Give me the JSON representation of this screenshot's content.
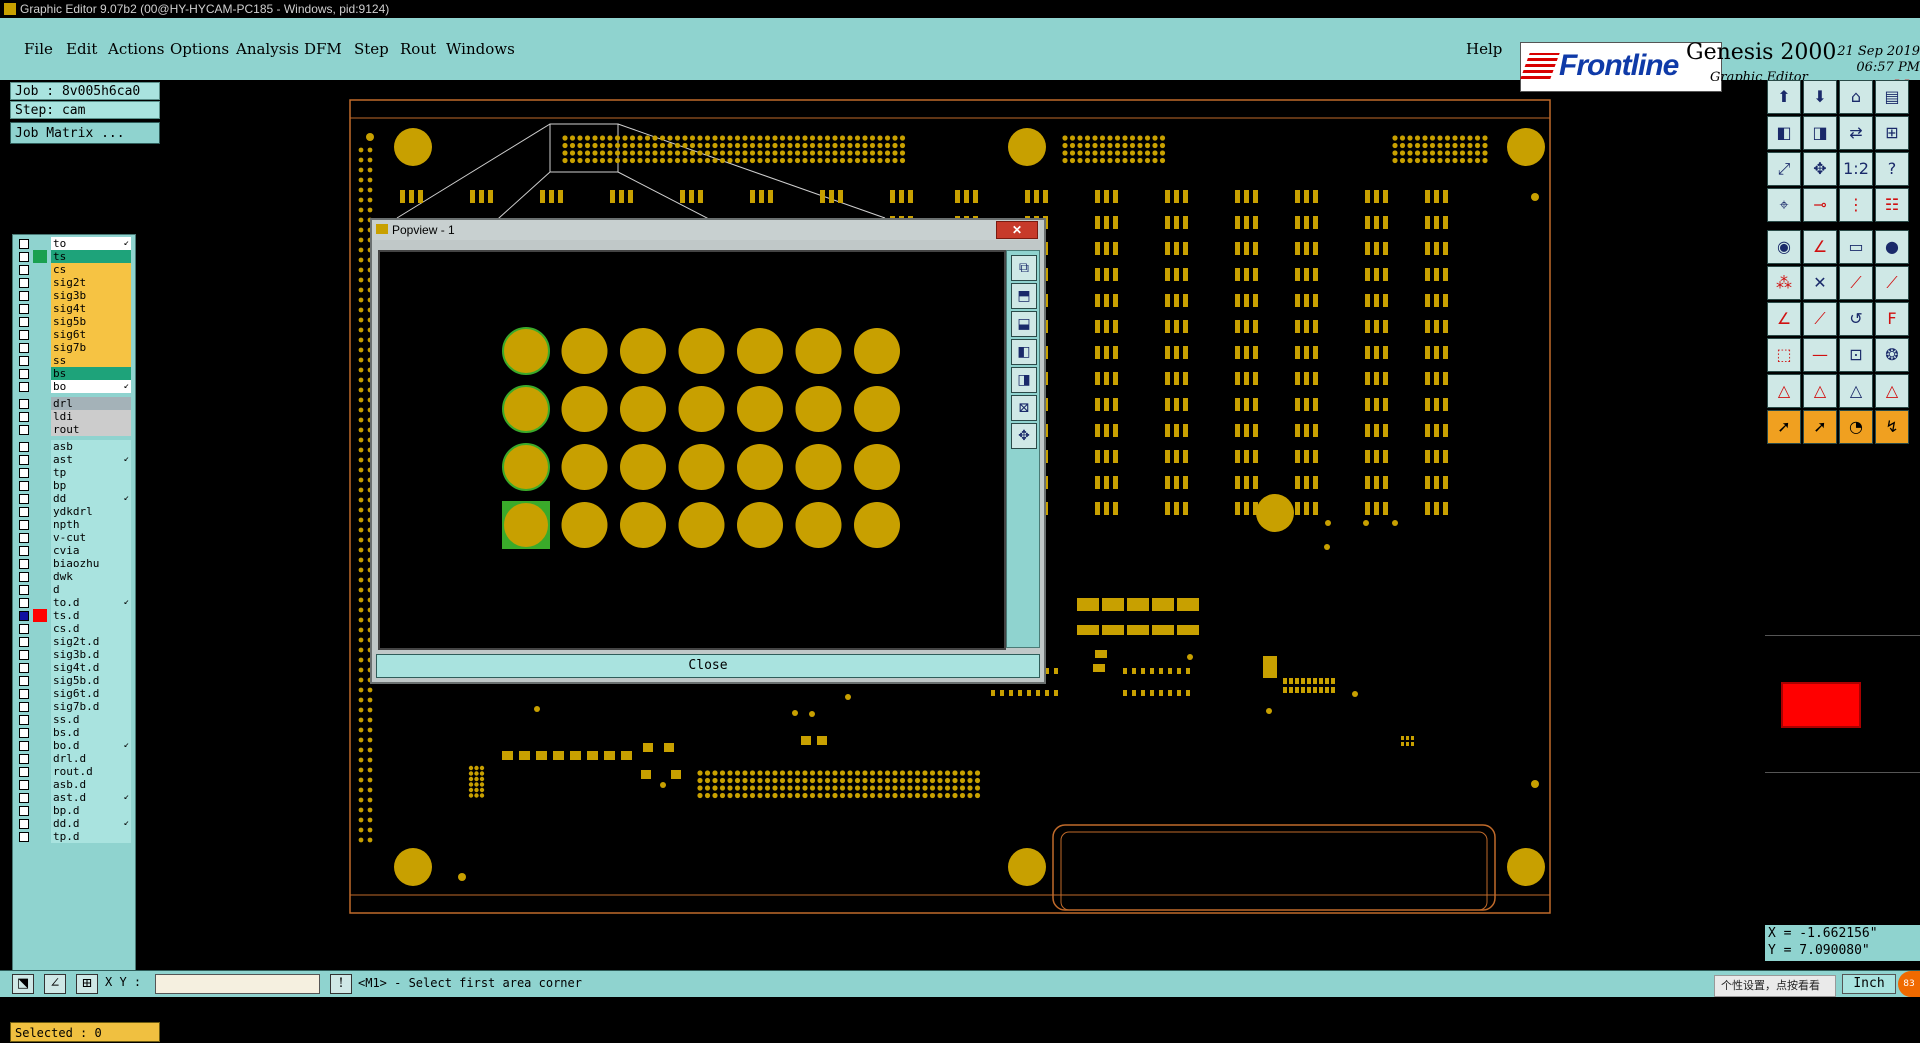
{
  "window": {
    "title": "Graphic Editor 9.07b2 (00@HY-HYCAM-PC185 - Windows, pid:9124)"
  },
  "menu": {
    "items": [
      "File",
      "Edit",
      "Actions",
      "Options",
      "Analysis",
      "DFM",
      "Step",
      "Rout",
      "Windows"
    ],
    "help": "Help"
  },
  "brand": {
    "logo": "Frontline",
    "product": "Genesis 2000",
    "subtitle": "Graphic Editor",
    "date": "21 Sep 2019\n06:57 PM"
  },
  "info": {
    "job": "Job : 8v005h6ca0",
    "step": "Step: cam",
    "matrix_button": "Job Matrix ..."
  },
  "layers": [
    {
      "name": "to",
      "color": "#ffffff",
      "arrow": true
    },
    {
      "name": "ts",
      "color": "#1ea37a",
      "marker": "#1aa050"
    },
    {
      "name": "cs",
      "color": "#f6c343"
    },
    {
      "name": "sig2t",
      "color": "#f6c343"
    },
    {
      "name": "sig3b",
      "color": "#f6c343"
    },
    {
      "name": "sig4t",
      "color": "#f6c343"
    },
    {
      "name": "sig5b",
      "color": "#f6c343"
    },
    {
      "name": "sig6t",
      "color": "#f6c343"
    },
    {
      "name": "sig7b",
      "color": "#f6c343"
    },
    {
      "name": "ss",
      "color": "#f6c343"
    },
    {
      "name": "bs",
      "color": "#1ea37a"
    },
    {
      "name": "bo",
      "color": "#ffffff",
      "arrow": true
    },
    {
      "name": "drl",
      "color": "#a4b2b8",
      "gap": true
    },
    {
      "name": "ldi",
      "color": "#cccccc"
    },
    {
      "name": "rout",
      "color": "#cccccc"
    },
    {
      "name": "asb",
      "color": "#a9e3df",
      "gap": true
    },
    {
      "name": "ast",
      "color": "#a9e3df",
      "arrow": true
    },
    {
      "name": "tp",
      "color": "#a9e3df"
    },
    {
      "name": "bp",
      "color": "#a9e3df"
    },
    {
      "name": "dd",
      "color": "#a9e3df",
      "arrow": true
    },
    {
      "name": "ydkdrl",
      "color": "#a9e3df"
    },
    {
      "name": "npth",
      "color": "#a9e3df"
    },
    {
      "name": "v-cut",
      "color": "#a9e3df"
    },
    {
      "name": "cvia",
      "color": "#a9e3df"
    },
    {
      "name": "biaozhu",
      "color": "#a9e3df"
    },
    {
      "name": "dwk",
      "color": "#a9e3df"
    },
    {
      "name": "d",
      "color": "#a9e3df"
    },
    {
      "name": "to.d",
      "color": "#a9e3df",
      "arrow": true
    },
    {
      "name": "ts.d",
      "color": "#a9e3df",
      "marker": "#ff0000",
      "active": true
    },
    {
      "name": "cs.d",
      "color": "#a9e3df"
    },
    {
      "name": "sig2t.d",
      "color": "#a9e3df"
    },
    {
      "name": "sig3b.d",
      "color": "#a9e3df"
    },
    {
      "name": "sig4t.d",
      "color": "#a9e3df"
    },
    {
      "name": "sig5b.d",
      "color": "#a9e3df"
    },
    {
      "name": "sig6t.d",
      "color": "#a9e3df"
    },
    {
      "name": "sig7b.d",
      "color": "#a9e3df"
    },
    {
      "name": "ss.d",
      "color": "#a9e3df"
    },
    {
      "name": "bs.d",
      "color": "#a9e3df"
    },
    {
      "name": "bo.d",
      "color": "#a9e3df",
      "arrow": true
    },
    {
      "name": "drl.d",
      "color": "#a9e3df"
    },
    {
      "name": "rout.d",
      "color": "#a9e3df"
    },
    {
      "name": "asb.d",
      "color": "#a9e3df"
    },
    {
      "name": "ast.d",
      "color": "#a9e3df",
      "arrow": true
    },
    {
      "name": "bp.d",
      "color": "#a9e3df"
    },
    {
      "name": "dd.d",
      "color": "#a9e3df",
      "arrow": true
    },
    {
      "name": "tp.d",
      "color": "#a9e3df"
    }
  ],
  "selected": "Selected : 0",
  "popview": {
    "title": "Popview - 1",
    "close_x": "✕",
    "close_button": "Close"
  },
  "coords": {
    "x": "X = -1.662156\"",
    "y": "Y = 7.090080\""
  },
  "bottom": {
    "xy_label": "X Y :",
    "xy_value": "",
    "status": "<M1> - Select first area corner",
    "ime_hint": "个性设置，点按看看",
    "units": "Inch",
    "badge": "83"
  },
  "colors": {
    "copper": "#c8a000",
    "panel": "#8fd3cf",
    "outline": "#c06a2a"
  }
}
